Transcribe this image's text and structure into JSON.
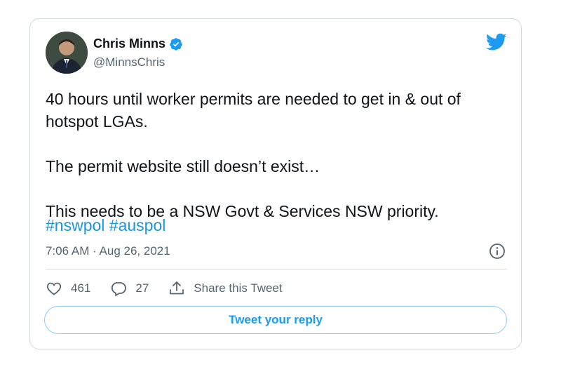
{
  "tweet": {
    "author_name": "Chris Minns",
    "author_handle": "@MinnsChris",
    "body": "40 hours until worker permits are needed to get in & out of hotspot LGAs.\n\nThe permit website still doesn’t exist…\n\nThis needs to be a NSW Govt & Services NSW priority.",
    "hashtags": [
      "#nswpol",
      "#auspol"
    ],
    "timestamp": "7:06 AM · Aug 26, 2021"
  },
  "actions": {
    "likes_count": "461",
    "replies_count": "27",
    "share_label": "Share this Tweet"
  },
  "reply_button_label": "Tweet your reply",
  "icons": {
    "brand": "twitter-bird-icon",
    "verified": "verified-badge-icon",
    "info": "info-icon",
    "like": "heart-icon",
    "reply": "comment-icon",
    "share": "share-icon"
  },
  "colors": {
    "accent": "#1d9bf0",
    "hashtag": "#1b95e0",
    "text": "#0f1419",
    "muted": "#536471",
    "border": "#cfd9de"
  }
}
